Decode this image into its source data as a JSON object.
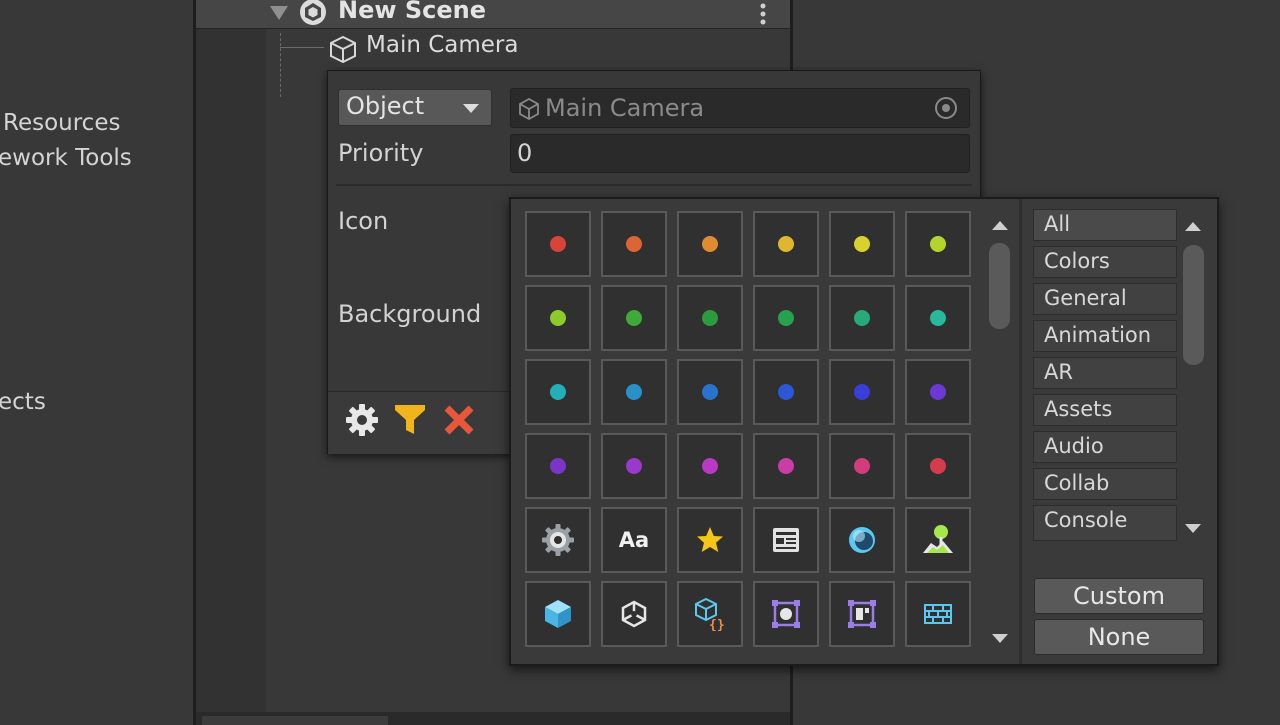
{
  "left_panel": {
    "items": [
      "Resources",
      "ework Tools",
      "ects"
    ]
  },
  "hierarchy": {
    "scene_name": "New Scene",
    "child_name": "Main Camera"
  },
  "annotation_panel": {
    "type_dropdown": "Object",
    "object_field_value": "Main Camera",
    "priority_label": "Priority",
    "priority_value": "0",
    "icon_label": "Icon",
    "background_label": "Background",
    "toolbar": {
      "settings": "gear-icon",
      "filter": "filter-icon",
      "remove": "close-icon"
    }
  },
  "icon_picker": {
    "color_dots": [
      "#d9433a",
      "#dc6534",
      "#df8b32",
      "#dfb630",
      "#d9d12d",
      "#b3d42c",
      "#8ccb2c",
      "#3daa3a",
      "#2c9a3f",
      "#27a050",
      "#27a97a",
      "#28b89a",
      "#23afb8",
      "#2a90c8",
      "#2a72cc",
      "#2c58d6",
      "#3a3ed8",
      "#6a3ad2",
      "#7b35c8",
      "#9a39cc",
      "#b83ac2",
      "#c93da4",
      "#d23c7c",
      "#d43c4c"
    ],
    "glyph_icons": [
      "settings-gear-icon",
      "text-aa-icon",
      "star-icon",
      "document-card-icon",
      "sphere-icon",
      "terrain-tree-icon",
      "cube-icon",
      "unity-logo-icon",
      "script-cube-icon",
      "transform-square-icon",
      "layout-panel-icon",
      "grid-icon"
    ],
    "text_icon_label": "Aa",
    "categories": [
      "All",
      "Colors",
      "General",
      "Animation",
      "AR",
      "Assets",
      "Audio",
      "Collab",
      "Console"
    ],
    "selected_category": "All",
    "custom_button": "Custom",
    "none_button": "None",
    "colors": {
      "star": "#f5c518",
      "filter": "#f0b41c",
      "remove": "#e8573a",
      "icon_blue": "#5ac8f0",
      "icon_purple": "#9a7ee6",
      "icon_green": "#a6e84a"
    }
  }
}
